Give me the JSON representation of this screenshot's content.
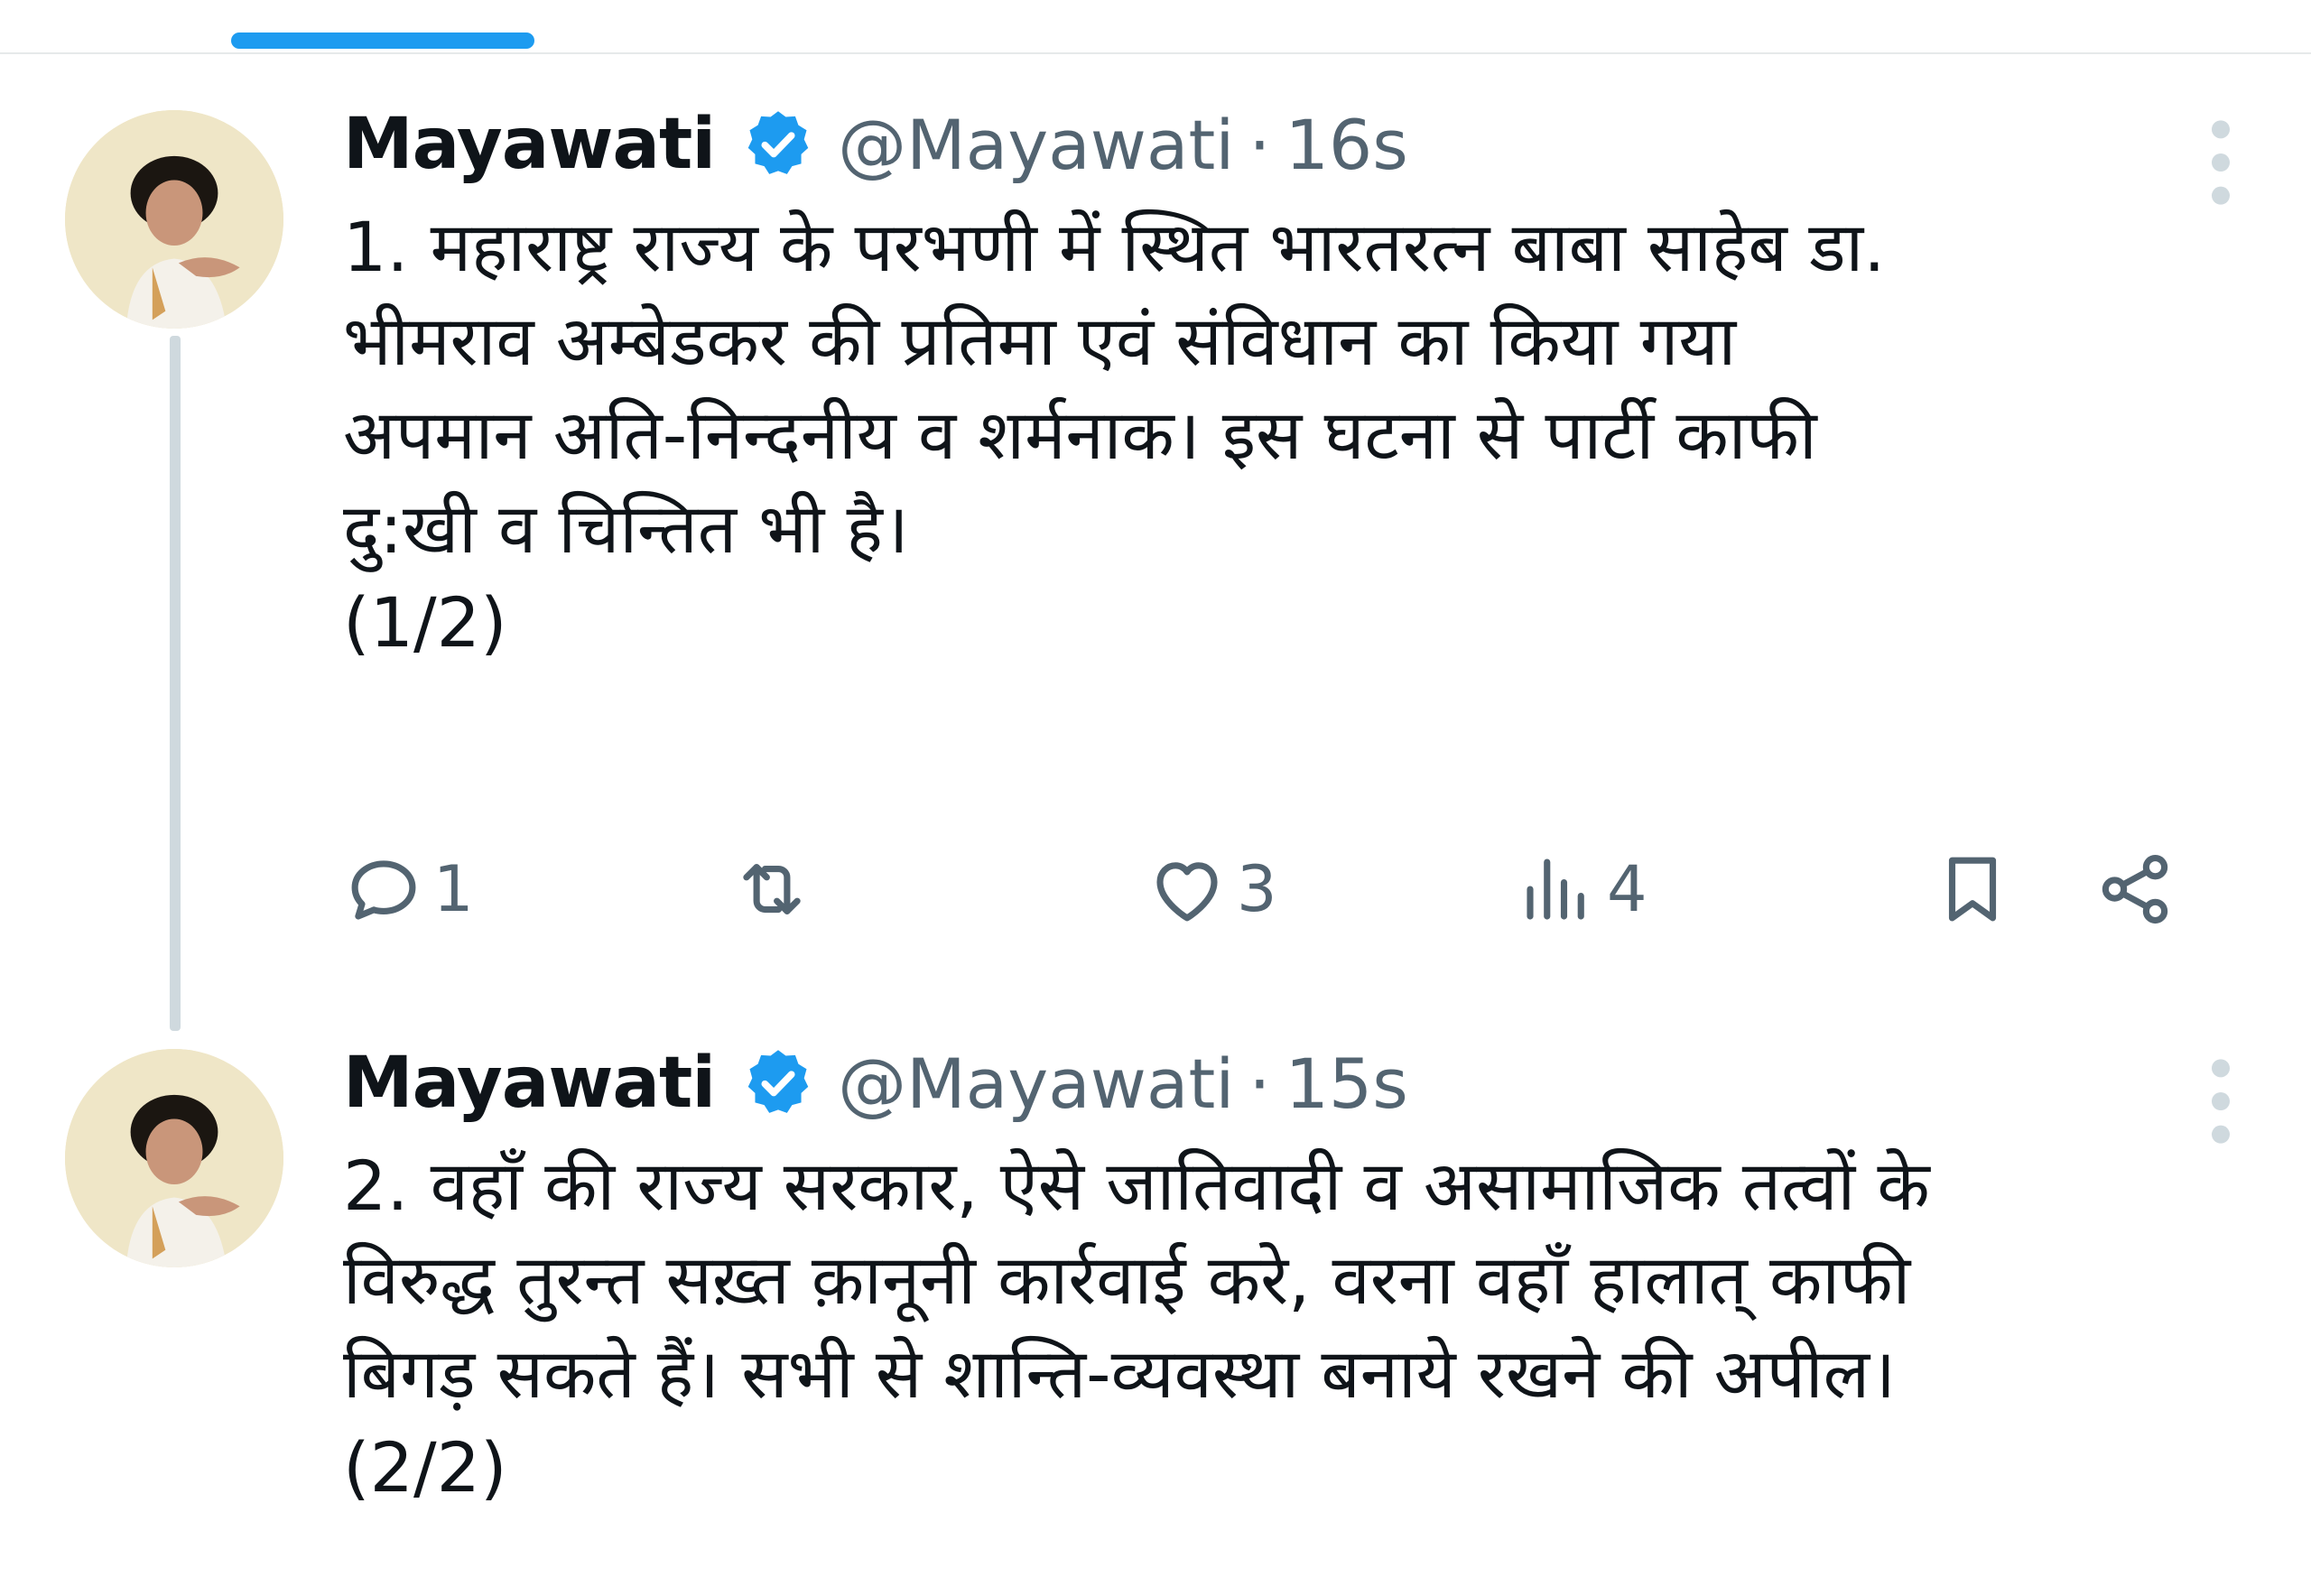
{
  "colors": {
    "accent": "#1d9bf0",
    "text_primary": "#0f1419",
    "text_secondary": "#536471",
    "thread_line": "#cfd9de"
  },
  "tweets": [
    {
      "display_name": "Mayawati",
      "handle": "@Mayawati",
      "separator": "·",
      "time": "16s",
      "verified_icon": "verified-badge-icon",
      "text_lines": [
        "1. महाराष्ट्र राज्य के परभणी में स्थित भारतरत्न बाबा साहेब डा.",
        "भीमराव अम्बेडकर की प्रतिमा एवं संविधान का किया गया",
        "अपमान अति-निन्दनीय व शर्मनाक। इस घटना से पार्टी काफी",
        "दु:खी व चिन्तित भी है।"
      ],
      "counter": "(1/2)",
      "actions": {
        "reply_count": "1",
        "retweet_count": "",
        "like_count": "3",
        "views_count": "4"
      }
    },
    {
      "display_name": "Mayawati",
      "handle": "@Mayawati",
      "separator": "·",
      "time": "15s",
      "verified_icon": "verified-badge-icon",
      "text_lines": [
        "2. वहाँ की राज्य सरकार, ऐसे जातिवादी व असामाजिक तत्वों के",
        "विरुद्ध तुरन्त सख़्त क़ानूनी कार्रवाई करे, वरना वहाँ हालात् काफी",
        "बिगड़ सकते हैं। सभी से शान्ति-व्यवस्था बनाये रखने की अपील।"
      ],
      "counter": "(2/2)"
    }
  ]
}
